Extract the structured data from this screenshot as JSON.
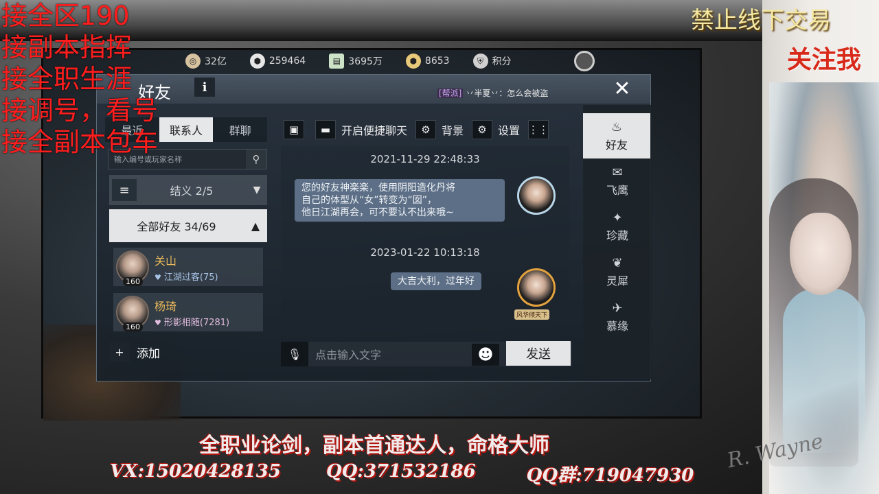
{
  "resources": [
    {
      "icon": "film-reel-icon",
      "value": "32亿",
      "color": "#d7c2a0"
    },
    {
      "icon": "ingot-icon",
      "value": "259464",
      "color": "#e6e6e6"
    },
    {
      "icon": "banknote-icon",
      "value": "3695万",
      "color": "#cde3c8"
    },
    {
      "icon": "gold-ingot-icon",
      "value": "8653",
      "color": "#e8c97a"
    },
    {
      "icon": "shield-icon",
      "value": "积分",
      "color": "#d0d0d0"
    }
  ],
  "panel": {
    "title": "好友",
    "info_label": "i",
    "ticker_tag": "[帮派]",
    "ticker_text": "丷半夏丷：怎么会被盗"
  },
  "left_tabs": [
    "最近",
    "联系人",
    "群聊"
  ],
  "search": {
    "placeholder": "输入编号或玩家名称"
  },
  "group": {
    "label": "结义 2/5"
  },
  "all_friends": {
    "label": "全部好友 34/69"
  },
  "friends": [
    {
      "name": "关山",
      "level": "160",
      "status": "江湖过客(75)"
    },
    {
      "name": "杨琦",
      "level": "160",
      "status": "形影相随(7281)"
    }
  ],
  "add_friend_label": "添加",
  "toolbar": {
    "quick_chat": "开启便捷聊天",
    "background": "背景",
    "settings": "设置"
  },
  "messages": [
    {
      "timestamp": "2021-11-29 22:48:33",
      "lines": [
        "您的好友神楽楽，使用阴阳造化丹将",
        "自己的体型从“女”转变为“囡”，",
        "他日江湖再会，可不要认不出来哦~"
      ]
    },
    {
      "timestamp": "2023-01-22 10:13:18",
      "lines": [
        "大吉大利，过年好"
      ],
      "badge": "风华倾天下"
    }
  ],
  "input": {
    "placeholder": "点击输入文字",
    "send_label": "发送"
  },
  "side_nav": [
    "好友",
    "飞鹰",
    "珍藏",
    "灵犀",
    "慕缘"
  ],
  "overlay": {
    "left_ads": [
      "接全区190",
      "接副本指挥",
      "接全职生涯",
      "接调号，看号",
      "接全副本包车"
    ],
    "top_right": "禁止线下交易",
    "follow": "关注我",
    "slogan": "全职业论剑，副本首通达人，命格大师",
    "contacts": [
      "VX:15020428135",
      "QQ:371532186",
      "QQ群:719047930"
    ],
    "signature": "R. Wayne"
  }
}
